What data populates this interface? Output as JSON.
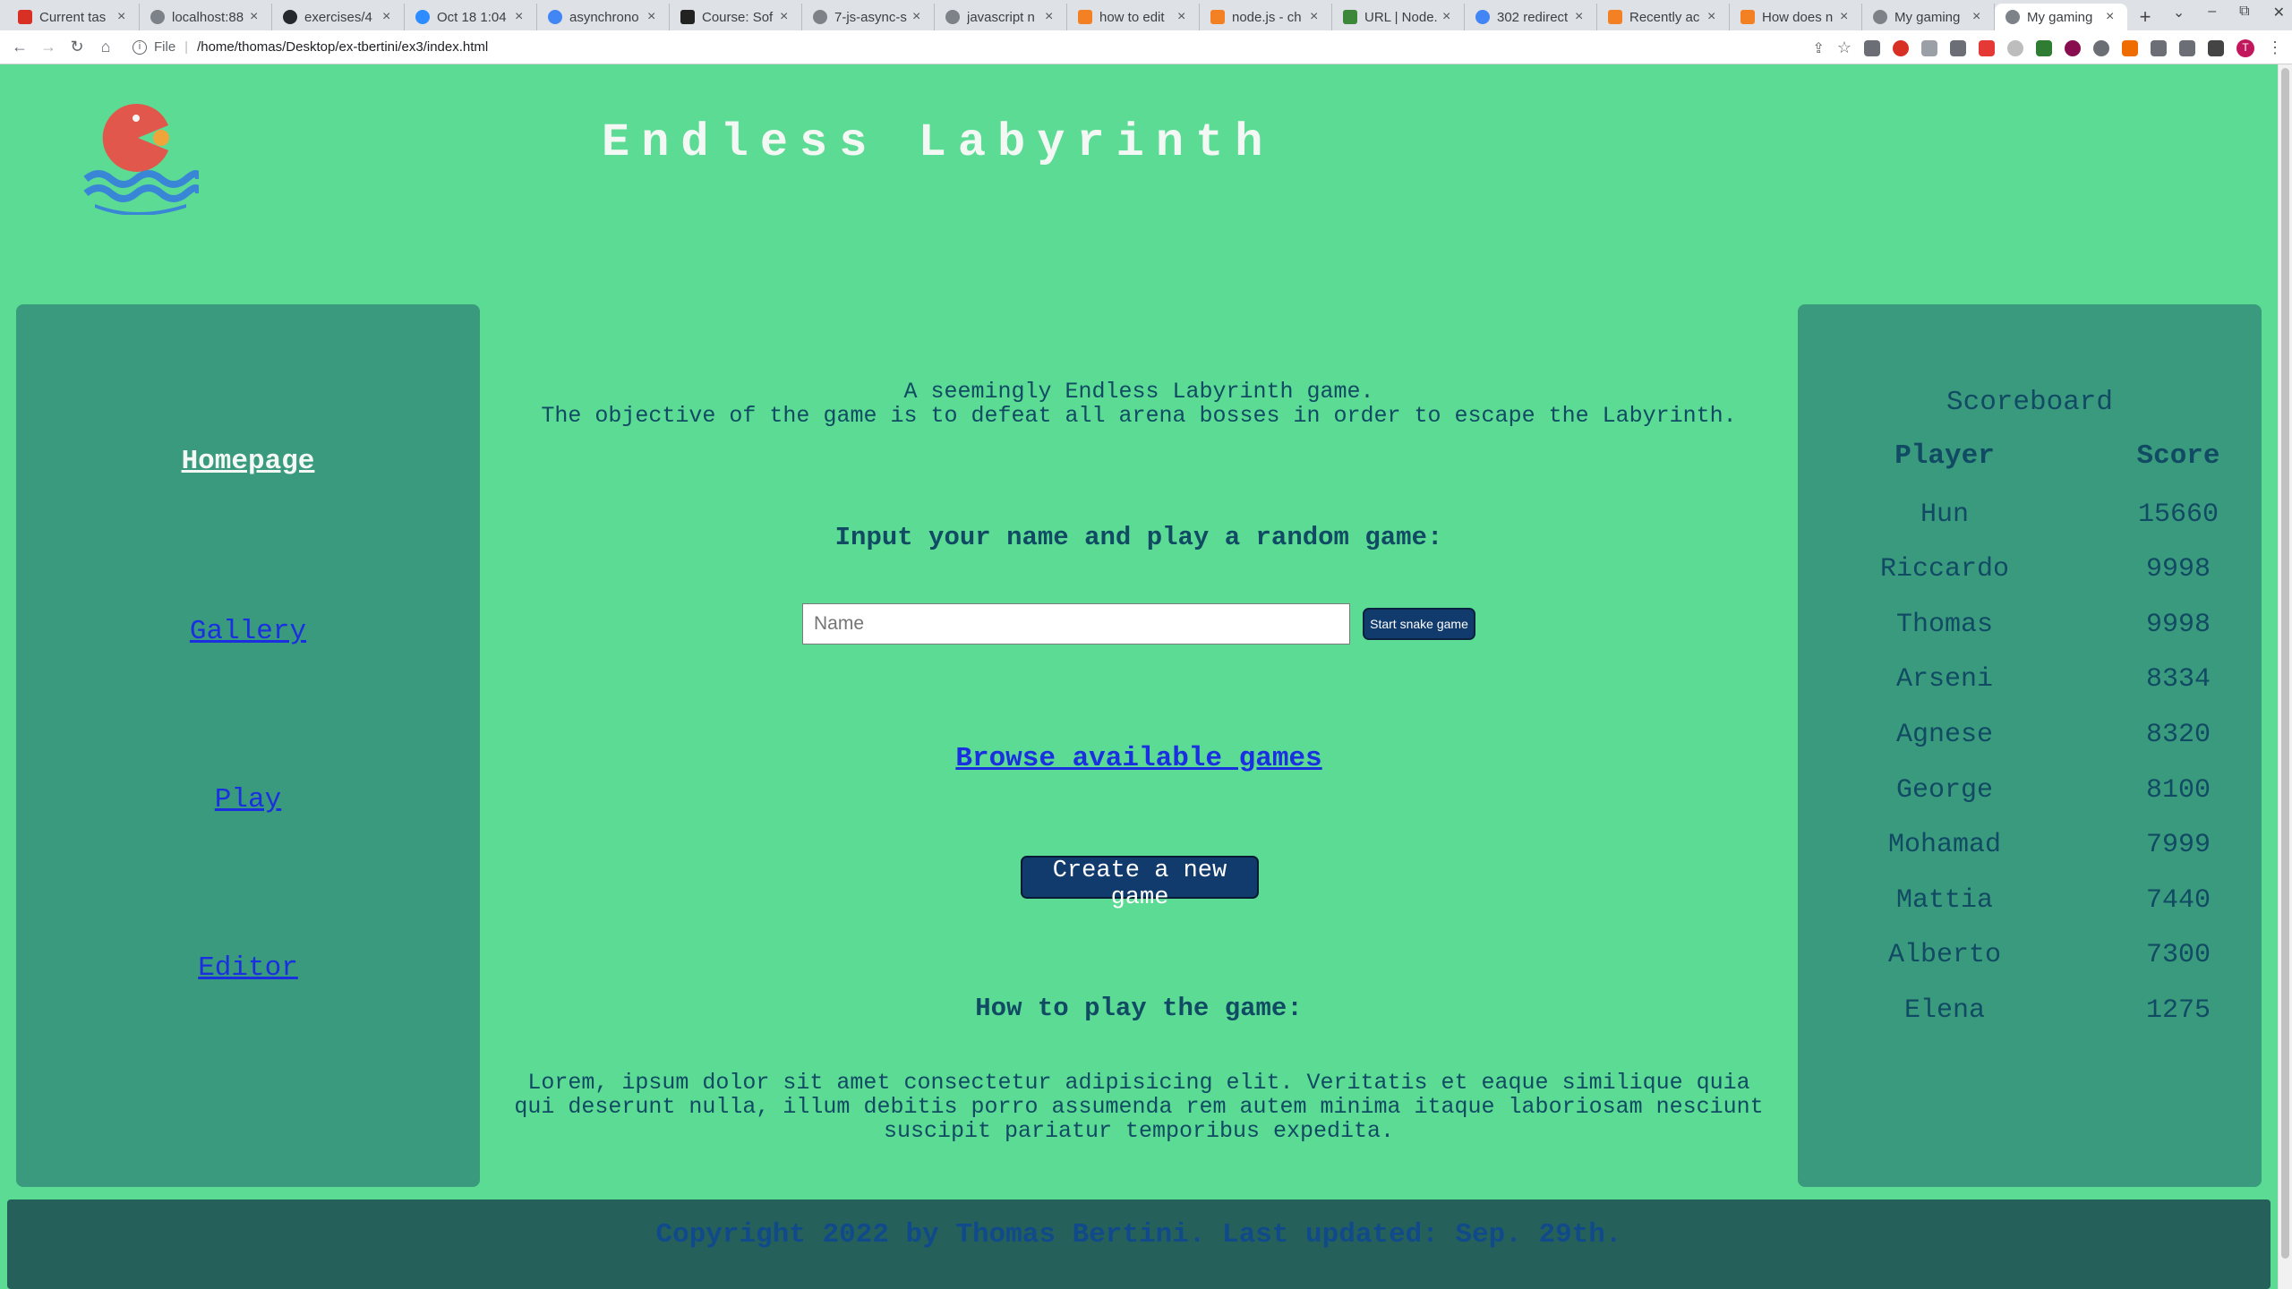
{
  "browser": {
    "tabs": [
      {
        "label": "Current tas",
        "icon": "gmail-icon"
      },
      {
        "label": "localhost:88",
        "icon": "globe-icon"
      },
      {
        "label": "exercises/4",
        "icon": "github-icon"
      },
      {
        "label": "Oct 18 1:04",
        "icon": "zoom-icon"
      },
      {
        "label": "asynchrono",
        "icon": "google-icon"
      },
      {
        "label": "Course: Sof",
        "icon": "moodle-icon"
      },
      {
        "label": "7-js-async-s",
        "icon": "globe-icon"
      },
      {
        "label": "javascript n",
        "icon": "globe-icon"
      },
      {
        "label": "how to edit",
        "icon": "stackoverflow-icon"
      },
      {
        "label": "node.js - ch",
        "icon": "stackoverflow-icon"
      },
      {
        "label": "URL | Node.",
        "icon": "nodejs-icon"
      },
      {
        "label": "302 redirect",
        "icon": "google-icon"
      },
      {
        "label": "Recently ac",
        "icon": "stackoverflow-icon"
      },
      {
        "label": "How does n",
        "icon": "stackoverflow-icon"
      },
      {
        "label": "My gaming",
        "icon": "globe-icon"
      },
      {
        "label": "My gaming",
        "icon": "globe-icon",
        "active": true
      }
    ],
    "address": {
      "scheme_label": "File",
      "url": "/home/thomas/Desktop/ex-tbertini/ex3/index.html"
    },
    "profile_initial": "T"
  },
  "site": {
    "title": "Endless Labyrinth",
    "accent_color": "#5bdb94",
    "panel_color": "#3a9a7e",
    "footer_color": "#25615a"
  },
  "sidebar": {
    "items": [
      {
        "label": "Homepage",
        "current": true
      },
      {
        "label": "Gallery"
      },
      {
        "label": "Play"
      },
      {
        "label": "Editor"
      }
    ]
  },
  "main": {
    "intro_line1": "A seemingly Endless Labyrinth game.",
    "intro_line2": "The objective of the game is to defeat all arena bosses in order to escape the Labyrinth.",
    "input_heading": "Input your name and play a random game:",
    "name_placeholder": "Name",
    "start_button": "Start snake game",
    "browse_link": "Browse available games",
    "create_button": "Create a new game",
    "howto_heading": "How to play the game:",
    "howto_text": "Lorem, ipsum dolor sit amet consectetur adipisicing elit. Veritatis et eaque similique quia qui deserunt nulla, illum debitis porro assumenda rem autem minima itaque laboriosam nesciunt suscipit pariatur temporibus expedita."
  },
  "scoreboard": {
    "title": "Scoreboard",
    "col_player": "Player",
    "col_score": "Score",
    "rows": [
      {
        "player": "Hun",
        "score": "15660"
      },
      {
        "player": "Riccardo",
        "score": "9998"
      },
      {
        "player": "Thomas",
        "score": "9998"
      },
      {
        "player": "Arseni",
        "score": "8334"
      },
      {
        "player": "Agnese",
        "score": "8320"
      },
      {
        "player": "George",
        "score": "8100"
      },
      {
        "player": "Mohamad",
        "score": "7999"
      },
      {
        "player": "Mattia",
        "score": "7440"
      },
      {
        "player": "Alberto",
        "score": "7300"
      },
      {
        "player": "Elena",
        "score": "1275"
      }
    ]
  },
  "footer": {
    "copyright": "Copyright 2022 by Thomas Bertini. Last updated: Sep. 29th."
  }
}
